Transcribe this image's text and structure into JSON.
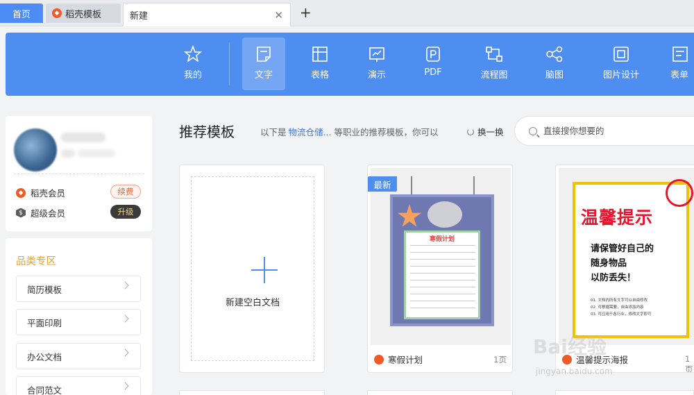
{
  "tabs": {
    "home": "首页",
    "daoke": "稻壳模板",
    "new_tab": "新建",
    "close": "✕",
    "add": "+"
  },
  "toolbar": {
    "items": [
      {
        "label": "我的",
        "icon": "star-icon"
      },
      {
        "label": "文字",
        "icon": "document-icon",
        "active": true
      },
      {
        "label": "表格",
        "icon": "table-icon"
      },
      {
        "label": "演示",
        "icon": "presentation-icon"
      },
      {
        "label": "PDF",
        "icon": "pdf-icon"
      },
      {
        "label": "流程图",
        "icon": "flowchart-icon"
      },
      {
        "label": "脑图",
        "icon": "mindmap-icon"
      },
      {
        "label": "图片设计",
        "icon": "image-design-icon"
      },
      {
        "label": "表单",
        "icon": "form-icon"
      }
    ]
  },
  "user": {
    "member1": "稻壳会员",
    "member1_action": "续费",
    "member2": "超级会员",
    "member2_action": "升级"
  },
  "categories": {
    "title": "品类专区",
    "items": [
      "简历模板",
      "平面印刷",
      "办公文档",
      "合同范文"
    ]
  },
  "main": {
    "title": "推荐模板",
    "desc_prefix": "以下是",
    "desc_link": "物流仓储...",
    "desc_suffix": "等职业的推荐模板，你可以",
    "swap": "换一换",
    "search_placeholder": "直接搜你想要的"
  },
  "cards": {
    "new_blank": "新建空白文档",
    "templates": [
      {
        "name": "寒假计划",
        "pages": "1页",
        "badge": "最新",
        "poster_title": "寒假计划"
      },
      {
        "name": "温馨提示海报",
        "pages": "1页",
        "poster_title": "温馨提示",
        "poster_body": [
          "请保管好自己的",
          "随身物品",
          "以防丢失！"
        ],
        "poster_notes": [
          "01. 文档内所有文字可以自由修改",
          "02. 可根据需要，自由添加内容",
          "03. 可应用于各行业，修改文字即可"
        ]
      }
    ]
  },
  "watermark": {
    "text": "Bai经验",
    "url_text": "jingyan.baidu.com"
  },
  "colors": {
    "accent": "#4e8ef0",
    "brand_orange": "#f05a29",
    "category_title": "#f0a128"
  }
}
